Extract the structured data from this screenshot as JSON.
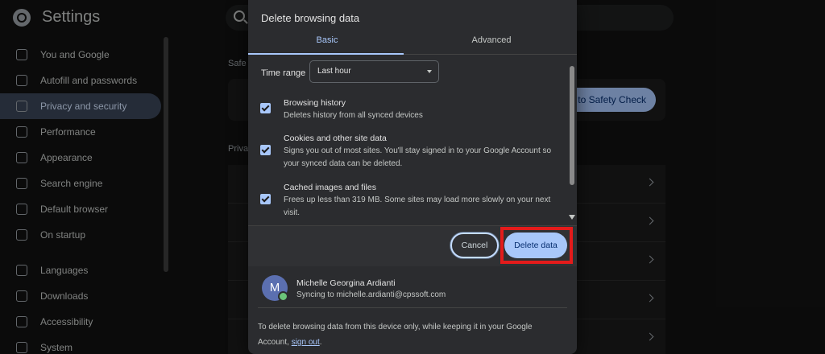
{
  "settings": {
    "title": "Settings",
    "sidebar": [
      {
        "label": "You and Google",
        "icon": "google-icon"
      },
      {
        "label": "Autofill and passwords",
        "icon": "key-icon"
      },
      {
        "label": "Privacy and security",
        "icon": "shield-icon",
        "selected": true
      },
      {
        "label": "Performance",
        "icon": "speedometer-icon"
      },
      {
        "label": "Appearance",
        "icon": "palette-icon"
      },
      {
        "label": "Search engine",
        "icon": "search-icon"
      },
      {
        "label": "Default browser",
        "icon": "browser-icon"
      },
      {
        "label": "On startup",
        "icon": "power-icon"
      },
      {
        "label": "Languages",
        "icon": "translate-icon"
      },
      {
        "label": "Downloads",
        "icon": "download-icon"
      },
      {
        "label": "Accessibility",
        "icon": "accessibility-icon"
      },
      {
        "label": "System",
        "icon": "wrench-icon"
      }
    ],
    "section_safety": "Safe",
    "section_privacy": "Priva",
    "safety_button": "Go to Safety Check"
  },
  "dialog": {
    "title": "Delete browsing data",
    "tabs": {
      "basic": "Basic",
      "advanced": "Advanced"
    },
    "time_range_label": "Time range",
    "time_range_value": "Last hour",
    "options": [
      {
        "title": "Browsing history",
        "desc": "Deletes history from all synced devices",
        "checked": true
      },
      {
        "title": "Cookies and other site data",
        "desc": "Signs you out of most sites. You'll stay signed in to your Google Account so your synced data can be deleted.",
        "checked": true
      },
      {
        "title": "Cached images and files",
        "desc": "Frees up less than 319 MB. Some sites may load more slowly on your next visit.",
        "checked": true
      }
    ],
    "cancel_label": "Cancel",
    "delete_label": "Delete data",
    "account": {
      "initial": "M",
      "name": "Michelle Georgina Ardianti",
      "sync": "Syncing to michelle.ardianti@cpssoft.com"
    },
    "note_prefix": "To delete browsing data from this device only, while keeping it in your Google Account, ",
    "note_link": "sign out",
    "note_suffix": "."
  },
  "colors": {
    "accent": "#a8c7fa",
    "highlight": "#e31b1b"
  }
}
